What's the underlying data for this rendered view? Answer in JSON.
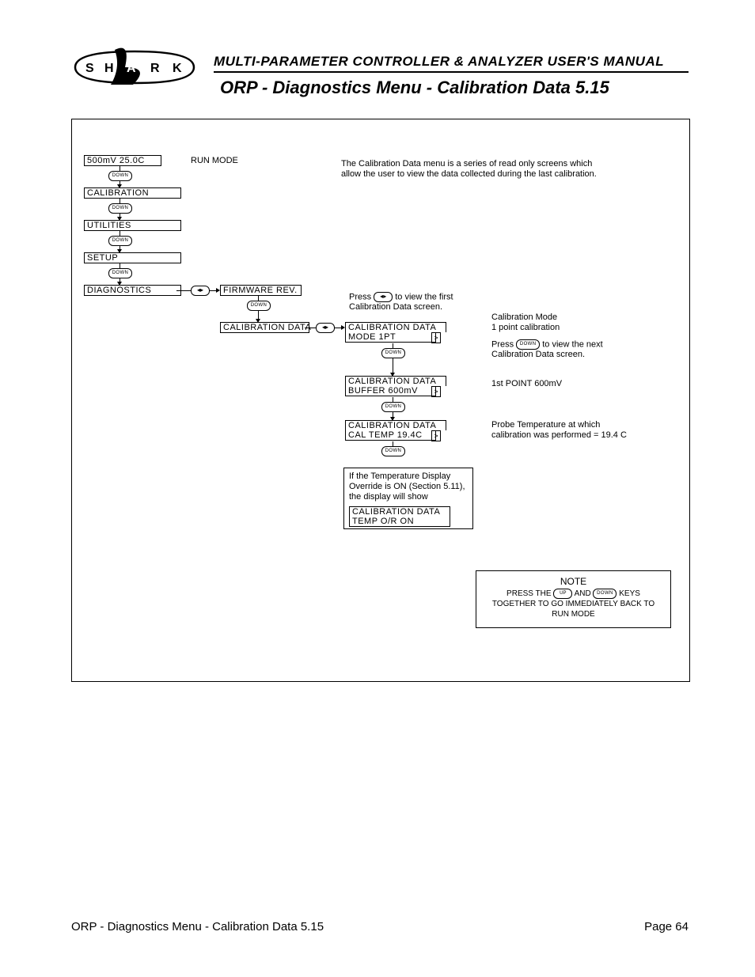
{
  "header": {
    "logo_letters": [
      "S",
      "H",
      "A",
      "R",
      "K"
    ],
    "line1": "MULTI-PARAMETER CONTROLLER & ANALYZER USER'S MANUAL",
    "line2": "ORP - Diagnostics Menu - Calibration Data 5.15"
  },
  "intro": "The Calibration Data menu is a series of read only screens which allow the user to view the data collected during the last calibration.",
  "menu": {
    "run": "500mV  25.0C",
    "run_label": "RUN MODE",
    "items": [
      "CALIBRATION",
      "UTILITIES",
      "SETUP",
      "DIAGNOSTICS"
    ],
    "firmware": "FIRMWARE REV.",
    "caldata": "CALIBRATION DATA"
  },
  "keys": {
    "down": "DOWN",
    "up": "UP",
    "right": "◂▸"
  },
  "right_hint": {
    "line1": "Press",
    "line2": "to view the first",
    "line3": "Calibration Data screen."
  },
  "screens": {
    "mode": {
      "t": "CALIBRATION DATA",
      "v": "MODE  1PT"
    },
    "buffer": {
      "t": "CALIBRATION DATA",
      "v": "BUFFER    600mV"
    },
    "caltemp": {
      "t": "CALIBRATION DATA",
      "v": "CAL  TEMP  19.4C"
    },
    "tempor": {
      "t": "CALIBRATION DATA",
      "v": "TEMP O/R ON"
    }
  },
  "desc": {
    "mode1": "Calibration Mode",
    "mode2": "1 point calibration",
    "mode3a": "Press",
    "mode3b": "to view the next",
    "mode4": "Calibration Data screen.",
    "buffer": "1st POINT   600mV",
    "caltemp1": "Probe Temperature at which",
    "caltemp2": "calibration was performed = 19.4 C"
  },
  "override_note": "If the Temperature Display Override is ON (Section 5.11), the display will show",
  "note": {
    "title": "NOTE",
    "line1a": "PRESS THE",
    "line1b": "AND",
    "line1c": "KEYS",
    "line2": "TOGETHER TO GO IMMEDIATELY BACK TO",
    "line3": "RUN MODE"
  },
  "footer": {
    "left": "ORP - Diagnostics Menu - Calibration Data 5.15",
    "right": "Page 64"
  }
}
